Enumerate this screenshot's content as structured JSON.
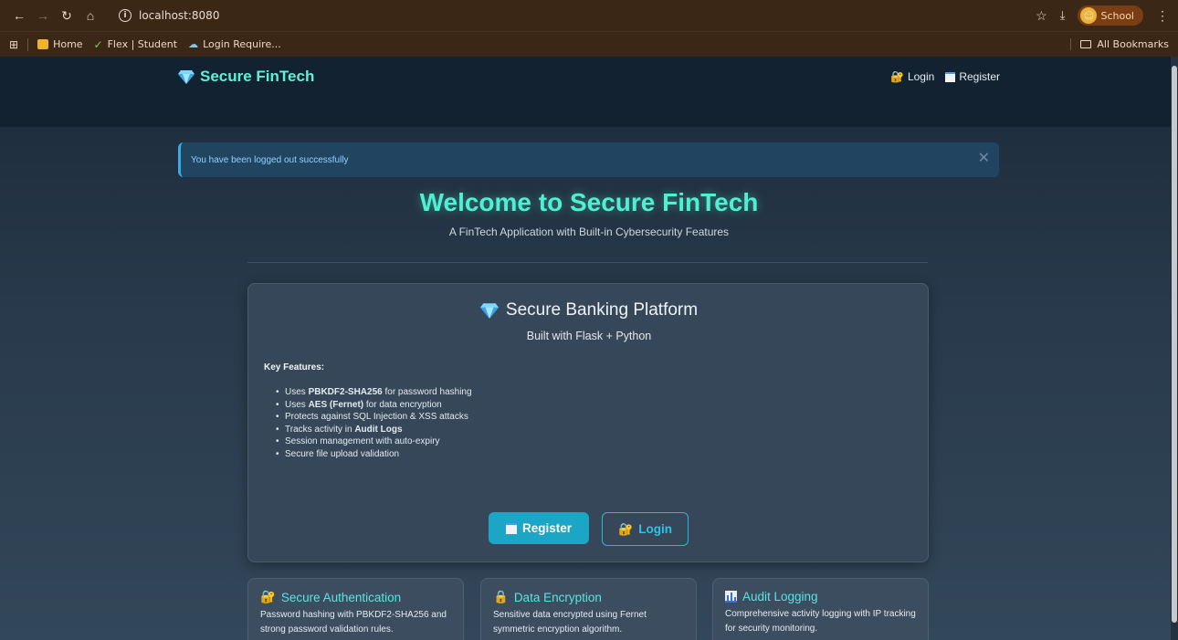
{
  "browser": {
    "url": "localhost:8080",
    "profile_label": "School",
    "bookmarks": [
      {
        "label": "Home"
      },
      {
        "label": "Flex | Student"
      },
      {
        "label": "Login Require..."
      }
    ],
    "all_bookmarks_label": "All Bookmarks"
  },
  "navbar": {
    "brand": "Secure FinTech",
    "login_label": "Login",
    "register_label": "Register"
  },
  "alert": {
    "message": "You have been logged out successfully"
  },
  "hero": {
    "title": "Welcome to Secure FinTech",
    "subtitle": "A FinTech Application with Built-in Cybersecurity Features"
  },
  "card": {
    "title": "Secure Banking Platform",
    "subtitle": "Built with Flask + Python",
    "features_heading": "Key Features:",
    "features": [
      {
        "pre": "Uses ",
        "bold": "PBKDF2-SHA256",
        "post": " for password hashing"
      },
      {
        "pre": "Uses ",
        "bold": "AES (Fernet)",
        "post": " for data encryption"
      },
      {
        "pre": "Protects against SQL Injection & XSS attacks",
        "bold": "",
        "post": ""
      },
      {
        "pre": "Tracks activity in ",
        "bold": "Audit Logs",
        "post": ""
      },
      {
        "pre": "Session management with auto-expiry",
        "bold": "",
        "post": ""
      },
      {
        "pre": "Secure file upload validation",
        "bold": "",
        "post": ""
      }
    ],
    "register_button": "Register",
    "login_button": "Login"
  },
  "mini_cards": [
    {
      "title": "Secure Authentication",
      "icon": "lock-key-icon",
      "text": "Password hashing with PBKDF2-SHA256 and strong password validation rules."
    },
    {
      "title": "Data Encryption",
      "icon": "lock-icon",
      "text": "Sensitive data encrypted using Fernet symmetric encryption algorithm."
    },
    {
      "title": "Audit Logging",
      "icon": "chart-icon",
      "text": "Comprehensive activity logging with IP tracking for security monitoring."
    }
  ],
  "colors": {
    "accent": "#4ff0d2",
    "primary_button": "#1aa6c4",
    "alert_bg": "#214561",
    "chrome": "#3b2716"
  }
}
